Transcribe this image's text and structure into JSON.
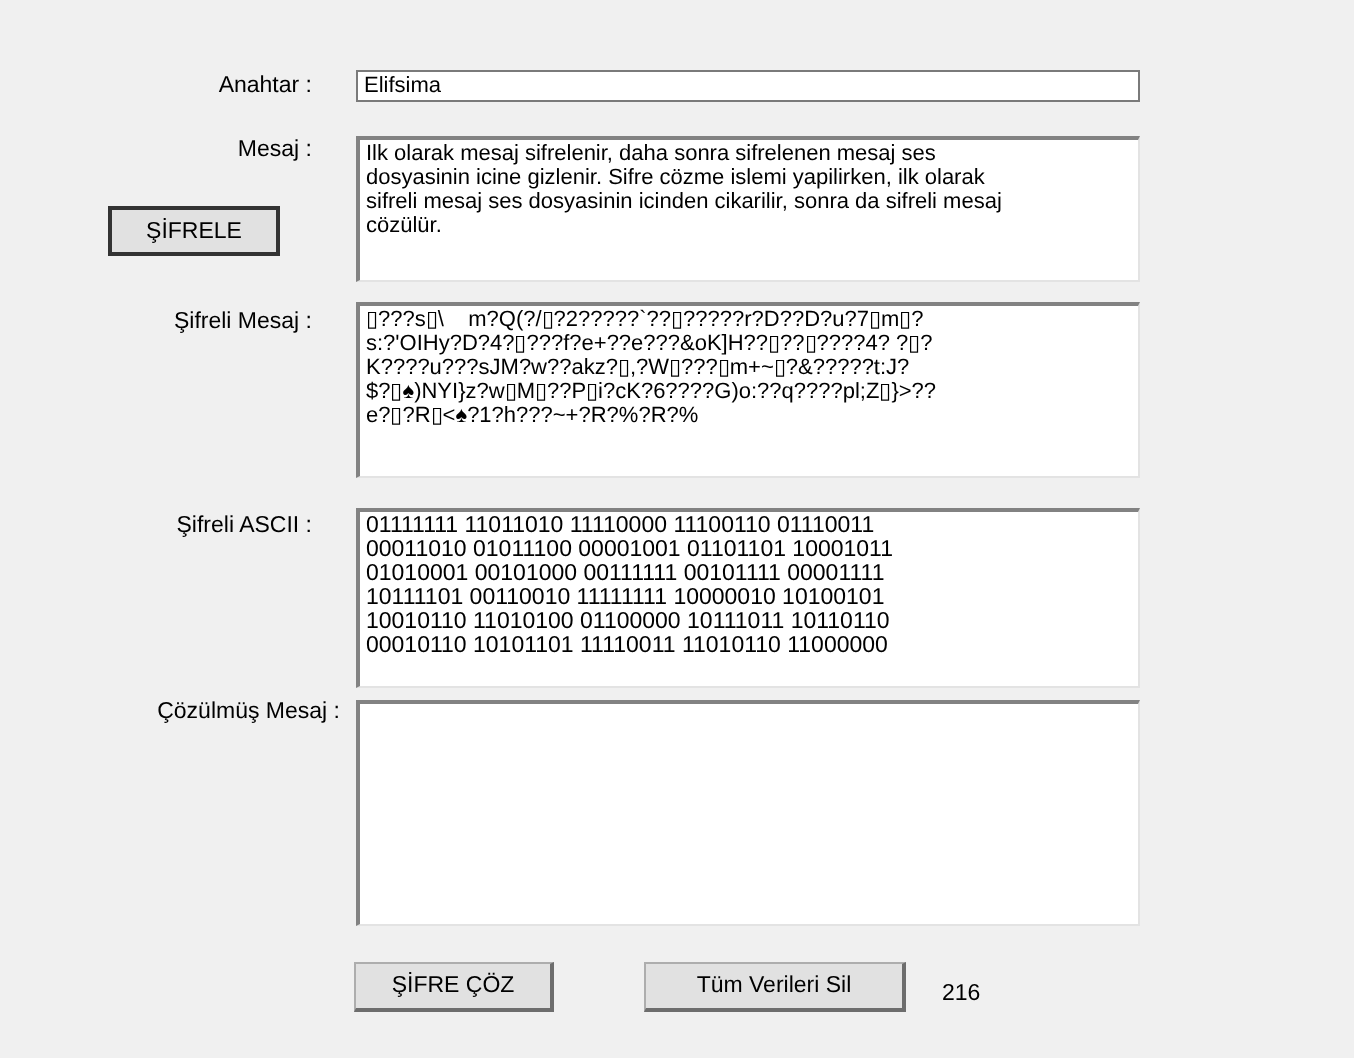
{
  "key": {
    "label": "Anahtar :",
    "value": "Elifsima"
  },
  "message": {
    "label": "Mesaj :",
    "value": "Ilk olarak mesaj sifrelenir, daha sonra sifrelenen mesaj ses dosyasinin icine gizlenir. Sifre cözme islemi yapilirken, ilk olarak sifreli mesaj ses dosyasinin icinden cikarilir, sonra da sifreli mesaj cözülür."
  },
  "encrypt_button": {
    "label": "ŞİFRELE",
    "focused": true
  },
  "encrypted_message": {
    "label": "Şifreli Mesaj :",
    "lines": [
      "▯???s▯\\    m?Q(?/▯?2?????`??▯?????r?D??D?u?7▯m▯?",
      "s:?'OIHy?D?4?▯???f?e+??e???&oK]H??▯??▯????4? ?▯?",
      "K????u???sJM?w??akz?▯,?W▯???▯m+~▯?&?????t:J?",
      "$?▯♠)NYI}z?w▯M▯??P▯i?cK?6????G)o:??q????pl;Z▯}>??",
      "e?▯?R▯<♠?1?h???~+?R?%?R?%"
    ]
  },
  "encrypted_ascii": {
    "label": "Şifreli ASCII :",
    "lines": [
      "01111111 11011010 11110000 11100110 01110011",
      "00011010 01011100 00001001 01101101 10001011",
      "01010001 00101000 00111111 00101111 00001111",
      "10111101 00110010 11111111 10000010 10100101",
      "10010110 11010100 01100000 10111011 10110110",
      "00010110 10101101 11110011 11010110 11000000"
    ]
  },
  "decrypted_message": {
    "label": "Çözülmüş Mesaj :"
  },
  "buttons": [
    {
      "label": "ŞİFRE ÇÖZ"
    },
    {
      "label": "Tüm Verileri Sil"
    }
  ],
  "count": "216"
}
